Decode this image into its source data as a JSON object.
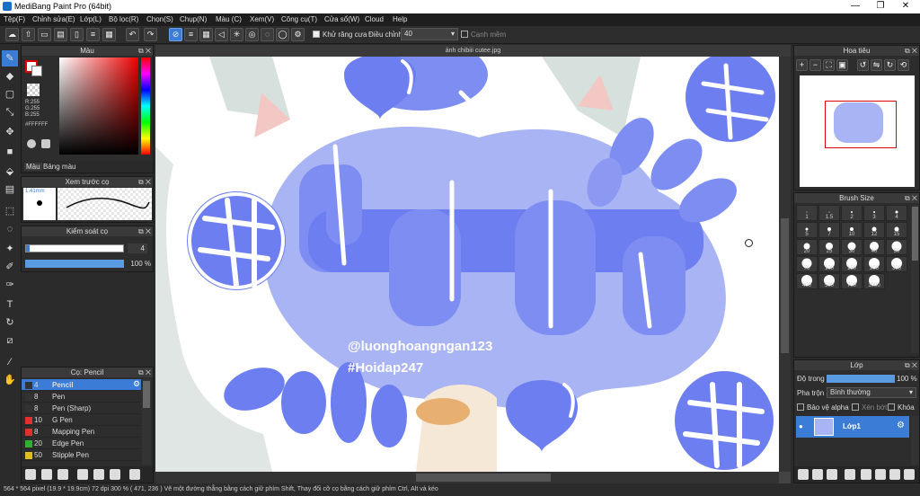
{
  "app": {
    "title": "MediBang Paint Pro (64bit)"
  },
  "window_controls": {
    "minimize": "—",
    "maximize": "❐",
    "close": "✕"
  },
  "menu": [
    "Tệp(F)",
    "Chỉnh sửa(E)",
    "Lớp(L)",
    "Bộ lọc(R)",
    "Chọn(S)",
    "Chụp(N)",
    "Màu (C)",
    "Xem(V)",
    "Công cụ(T)",
    "Cửa sổ(W)",
    "Cloud",
    "Help"
  ],
  "toolbar": {
    "antialias_label": "Khử răng cưa",
    "adjust_label": "Điều chỉnh",
    "adjust_value": "40",
    "edge_label": "Cạnh mềm"
  },
  "color_panel": {
    "title": "Màu",
    "r": "R:255",
    "g": "G:255",
    "b": "B:255",
    "hex": "#FFFFFF",
    "tab_color": "Màu",
    "tab_palette": "Bảng màu"
  },
  "brush_preview": {
    "title": "Xem trước cọ",
    "size": "1.41mm"
  },
  "brush_control": {
    "title": "Kiểm soát cọ",
    "size_value": "4",
    "opacity_value": "100 %"
  },
  "brush_list": {
    "title": "Cọ: Pencil",
    "items": [
      {
        "size": "4",
        "name": "Pencil",
        "color": "#333333"
      },
      {
        "size": "8",
        "name": "Pen",
        "color": "#333333"
      },
      {
        "size": "8",
        "name": "Pen (Sharp)",
        "color": "#333333"
      },
      {
        "size": "10",
        "name": "G Pen",
        "color": "#e03030"
      },
      {
        "size": "8",
        "name": "Mapping Pen",
        "color": "#e03030"
      },
      {
        "size": "20",
        "name": "Edge Pen",
        "color": "#30b030"
      },
      {
        "size": "50",
        "name": "Stipple Pen",
        "color": "#e0c020"
      }
    ]
  },
  "document": {
    "tab_name": "ảnh chibiii cutee.jpg"
  },
  "watermark": {
    "line1": "@luonghoangngan123",
    "line2": "#Hoidap247"
  },
  "navigator": {
    "title": "Hoa tiêu"
  },
  "brush_size": {
    "title": "Brush Size",
    "sizes": [
      "1",
      "1.5",
      "2",
      "3",
      "4",
      "5",
      "7",
      "10",
      "12",
      "15",
      "20",
      "25",
      "30",
      "40",
      "50",
      "70",
      "100",
      "150",
      "200",
      "300",
      "400",
      "500",
      "700",
      "1000"
    ]
  },
  "layer_panel": {
    "title": "Lớp",
    "opacity_label": "Độ trong",
    "opacity_value": "100 %",
    "blend_label": "Pha trộn",
    "blend_value": "Bình thường",
    "protect_alpha": "Bảo vệ alpha",
    "clip": "Xén bớt",
    "lock": "Khóa",
    "layer_name": "Lớp1"
  },
  "status": {
    "text": "564 * 564 pixel   (19.9 * 19.9cm)   72 dpi   300 %   ( 471, 236 )   Vẽ một đường thẳng bằng cách giữ phím Shift, Thay đổi cỡ cọ bằng cách giữ phím Ctrl, Alt và kéo"
  },
  "colors": {
    "accent": "#3a7cd6",
    "panel": "#2d2d2d",
    "blob": "#a9b4f5",
    "blob_dark": "#6d7ff0"
  }
}
